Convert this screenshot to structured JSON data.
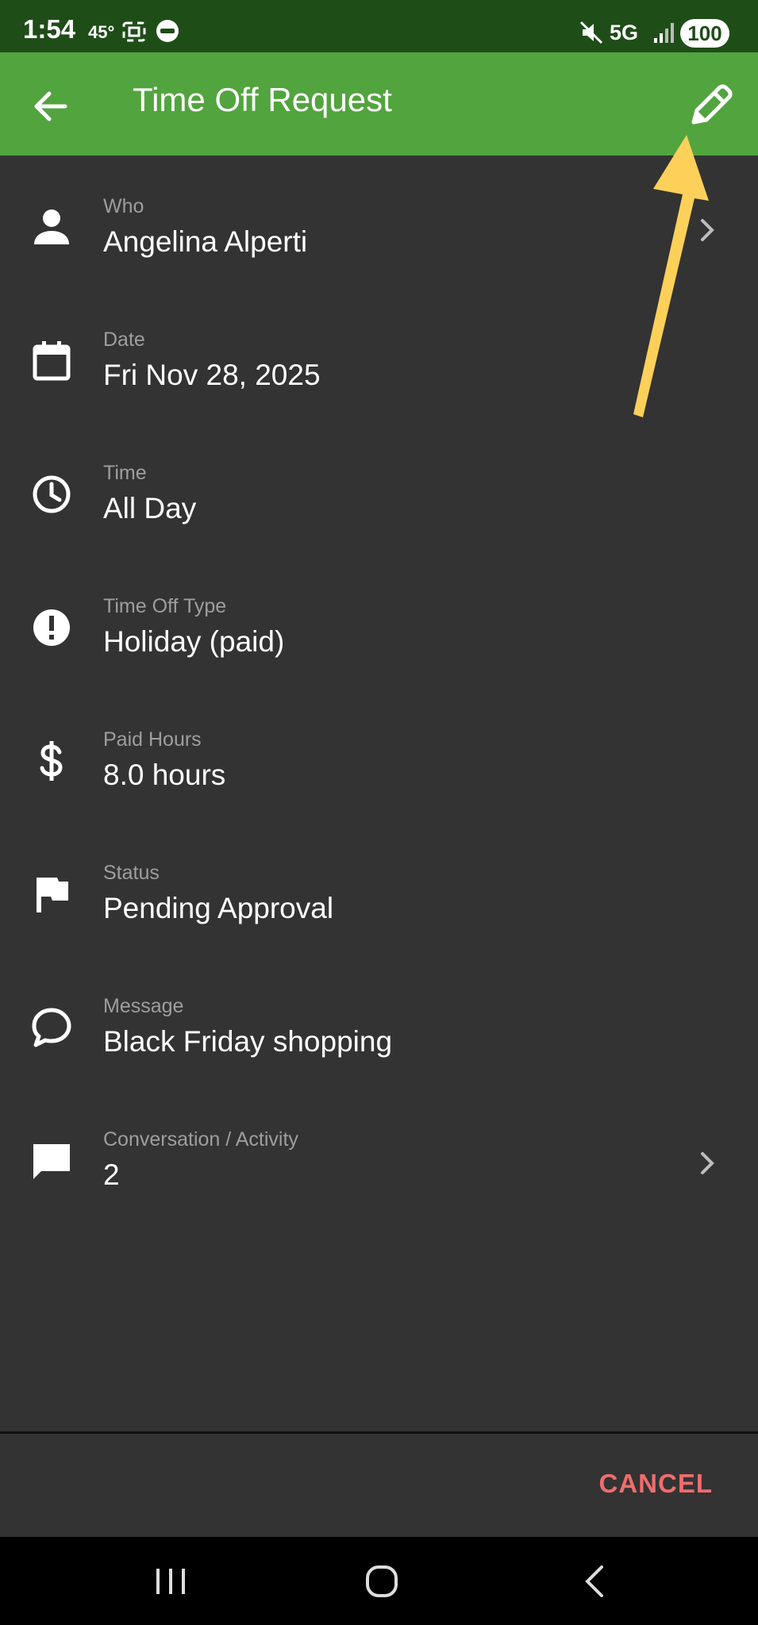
{
  "status_bar": {
    "time": "1:54",
    "temp": "45°",
    "network": "5G",
    "battery": "100"
  },
  "app_bar": {
    "title": "Time Off Request",
    "back_icon": "arrow-left-icon",
    "edit_icon": "pencil-icon"
  },
  "rows": [
    {
      "label": "Who",
      "value": "Angelina Alperti",
      "icon": "person-icon",
      "navigable": true
    },
    {
      "label": "Date",
      "value": "Fri Nov 28, 2025",
      "icon": "calendar-icon",
      "navigable": false
    },
    {
      "label": "Time",
      "value": "All Day",
      "icon": "clock-icon",
      "navigable": false
    },
    {
      "label": "Time Off Type",
      "value": "Holiday (paid)",
      "icon": "alert-circle-icon",
      "navigable": false
    },
    {
      "label": "Paid Hours",
      "value": "8.0 hours",
      "icon": "dollar-icon",
      "navigable": false
    },
    {
      "label": "Status",
      "value": "Pending Approval",
      "icon": "flag-icon",
      "navigable": false
    },
    {
      "label": "Message",
      "value": "Black Friday shopping",
      "icon": "chat-bubble-outline-icon",
      "navigable": false
    },
    {
      "label": "Conversation / Activity",
      "value": "2",
      "icon": "comment-icon",
      "navigable": true
    }
  ],
  "actions": {
    "cancel_label": "CANCEL"
  },
  "colors": {
    "status_bar": "#1f4d18",
    "app_bar": "#52a43e",
    "background": "#333333",
    "label": "#9e9e9e",
    "cancel": "#ef6d6d",
    "annotation_arrow": "#fdd05a"
  }
}
